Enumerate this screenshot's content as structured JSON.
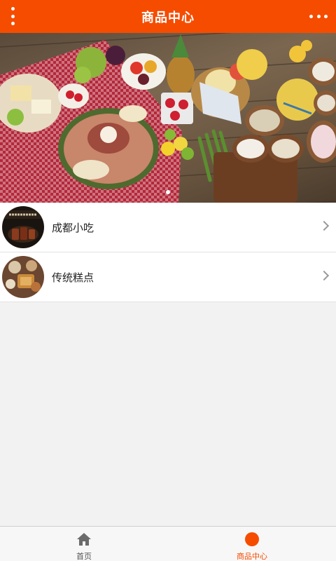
{
  "header": {
    "title": "商品中心",
    "menu_icon": "kebab-menu-icon",
    "more_icon": "more-horizontal-icon",
    "color": "#f64c00"
  },
  "banner": {
    "image": "picnic-food-spread-photo",
    "slides": 1,
    "active_slide": 1
  },
  "categories": [
    {
      "label": "成都小吃",
      "thumbnail": "chengdu-snack-thumbnail",
      "icon": "chevron-right-icon"
    },
    {
      "label": "传统糕点",
      "thumbnail": "traditional-pastry-thumbnail",
      "icon": "chevron-right-icon"
    }
  ],
  "tabbar": {
    "tabs": [
      {
        "label": "首页",
        "icon": "home-icon",
        "active": false
      },
      {
        "label": "商品中心",
        "icon": "circle-icon",
        "active": true
      }
    ],
    "active_color": "#f64c00"
  }
}
